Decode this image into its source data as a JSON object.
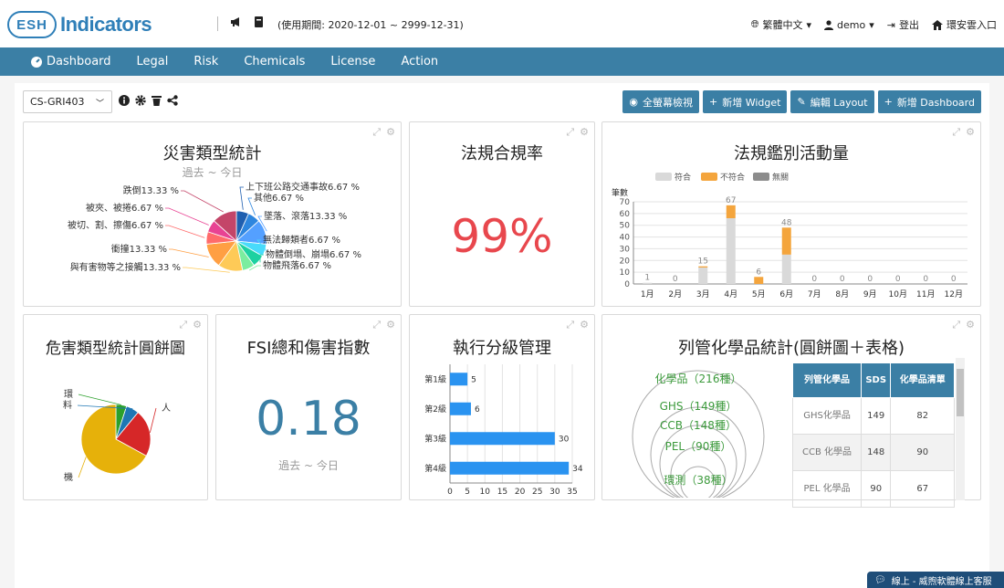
{
  "header": {
    "logo_badge": "ESH",
    "logo_text": "Indicators",
    "period": "(使用期間: 2020-12-01 ~ 2999-12-31)",
    "language": "繁體中文",
    "user": "demo",
    "logout": "登出",
    "portal": "環安雲入口"
  },
  "nav": [
    "Dashboard",
    "Legal",
    "Risk",
    "Chemicals",
    "License",
    "Action"
  ],
  "toolbar": {
    "select": "CS-GRI403",
    "fullscreen": "全螢幕檢視",
    "add_widget": "新增 Widget",
    "edit_layout": "編輯 Layout",
    "add_dashboard": "新增 Dashboard"
  },
  "widgets": {
    "disaster": {
      "title": "災害類型統計",
      "subtitle": "過去 ~ 今日",
      "labels": [
        "上下班公路交通事故6.67 %",
        "其他6.67 %",
        "墜落、滾落13.33 %",
        "無法歸類者6.67 %",
        "物體倒塌、崩塌6.67 %",
        "物體飛落6.67 %",
        "與有害物等之接觸13.33 %",
        "衝撞13.33 %",
        "被切、割、擦傷6.67 %",
        "被夾、被捲6.67 %",
        "跌倒13.33 %"
      ],
      "colors": [
        "#1f5fb0",
        "#2e86de",
        "#54a0ff",
        "#48dbfb",
        "#1dd1a1",
        "#7bed9f",
        "#feca57",
        "#ff9f43",
        "#ff6b6b",
        "#e84393",
        "#c44569"
      ]
    },
    "compliance": {
      "title": "法規合規率",
      "value": "99%"
    },
    "activity": {
      "title": "法規鑑別活動量",
      "legend": [
        "符合",
        "不符合",
        "無關"
      ],
      "legend_colors": [
        "#d9d9d9",
        "#f4a53d",
        "#8c8c8c"
      ],
      "yunit": "筆數"
    },
    "hazard": {
      "title": "危害類型統計圓餅圖",
      "labels": [
        "環",
        "料",
        "人",
        "機"
      ],
      "colors": [
        "#2ca02c",
        "#1f77b4",
        "#d62728",
        "#e6b10a"
      ]
    },
    "fsi": {
      "title": "FSI總和傷害指數",
      "value": "0.18",
      "subtitle": "過去 ~ 今日"
    },
    "levels": {
      "title": "執行分級管理"
    },
    "chem": {
      "title": "列管化學品統計(圓餅圖＋表格)",
      "bubbles": [
        "化學品（216種）",
        "GHS（149種）",
        "CCB（148種）",
        "PEL（90種）",
        "環測（38種）"
      ],
      "headers": [
        "列管化學品",
        "SDS",
        "化學品清單"
      ],
      "rows": [
        [
          "GHS化學品",
          "149",
          "82"
        ],
        [
          "CCB 化學品",
          "148",
          "90"
        ],
        [
          "PEL 化學品",
          "90",
          "67"
        ]
      ]
    }
  },
  "chat": "線上 - 威煦軟體線上客服",
  "chart_data": [
    {
      "type": "pie",
      "title": "災害類型統計",
      "categories": [
        "上下班公路交通事故",
        "其他",
        "墜落、滾落",
        "無法歸類者",
        "物體倒塌、崩塌",
        "物體飛落",
        "與有害物等之接觸",
        "衝撞",
        "被切、割、擦傷",
        "被夾、被捲",
        "跌倒"
      ],
      "values": [
        6.67,
        6.67,
        13.33,
        6.67,
        6.67,
        6.67,
        13.33,
        13.33,
        6.67,
        6.67,
        13.33
      ]
    },
    {
      "type": "bar",
      "title": "法規鑑別活動量",
      "ylabel": "筆數",
      "categories": [
        "1月",
        "2月",
        "3月",
        "4月",
        "5月",
        "6月",
        "7月",
        "8月",
        "9月",
        "10月",
        "11月",
        "12月"
      ],
      "series": [
        {
          "name": "符合",
          "values": [
            1,
            0,
            14,
            56,
            0,
            25,
            0,
            0,
            0,
            0,
            0,
            0
          ]
        },
        {
          "name": "不符合",
          "values": [
            0,
            0,
            1,
            11,
            6,
            23,
            0,
            0,
            0,
            0,
            0,
            0
          ]
        },
        {
          "name": "無關",
          "values": [
            0,
            0,
            0,
            0,
            0,
            0,
            0,
            0,
            0,
            0,
            0,
            0
          ]
        }
      ],
      "totals": [
        1,
        0,
        15,
        67,
        6,
        48,
        0,
        0,
        0,
        0,
        0,
        0
      ],
      "ylim": [
        0,
        70
      ],
      "yticks": [
        0,
        10,
        20,
        30,
        40,
        50,
        60,
        70
      ]
    },
    {
      "type": "pie",
      "title": "危害類型統計圓餅圖",
      "categories": [
        "環",
        "料",
        "人",
        "機"
      ],
      "values": [
        5,
        6,
        22,
        67
      ]
    },
    {
      "type": "bar",
      "title": "執行分級管理",
      "categories": [
        "第1級",
        "第2級",
        "第3級",
        "第4級"
      ],
      "values": [
        5,
        6,
        30,
        34
      ],
      "xlim": [
        0,
        35
      ],
      "xticks": [
        0,
        5,
        10,
        15,
        20,
        25,
        30,
        35
      ]
    }
  ]
}
